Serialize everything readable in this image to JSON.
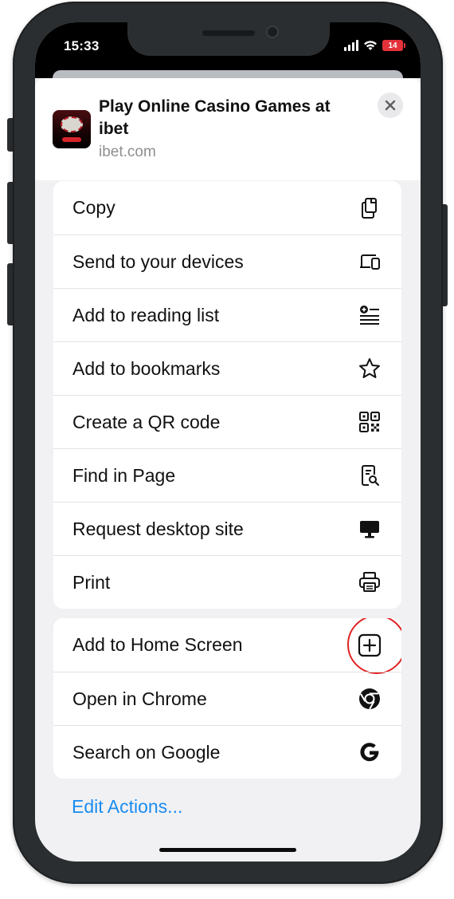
{
  "status_bar": {
    "time": "15:33",
    "battery": "14"
  },
  "share_sheet": {
    "site_title": "Play Online Casino Games at ibet",
    "site_url": "ibet.com",
    "close_icon": "close-icon"
  },
  "actions_group1": [
    {
      "label": "Copy",
      "icon": "copy-icon"
    },
    {
      "label": "Send to your devices",
      "icon": "devices-icon"
    },
    {
      "label": "Add to reading list",
      "icon": "reading-list-icon"
    },
    {
      "label": "Add to bookmarks",
      "icon": "star-icon"
    },
    {
      "label": "Create a QR code",
      "icon": "qr-code-icon"
    },
    {
      "label": "Find in Page",
      "icon": "find-in-page-icon"
    },
    {
      "label": "Request desktop site",
      "icon": "desktop-icon"
    },
    {
      "label": "Print",
      "icon": "print-icon"
    }
  ],
  "actions_group2": [
    {
      "label": "Add to Home Screen",
      "icon": "add-square-icon",
      "highlighted": true
    },
    {
      "label": "Open in Chrome",
      "icon": "chrome-icon"
    },
    {
      "label": "Search on Google",
      "icon": "google-icon"
    }
  ],
  "edit_actions_label": "Edit Actions...",
  "colors": {
    "link": "#1a8cf0",
    "highlight_ring": "#e02424",
    "battery": "#e3323a"
  }
}
